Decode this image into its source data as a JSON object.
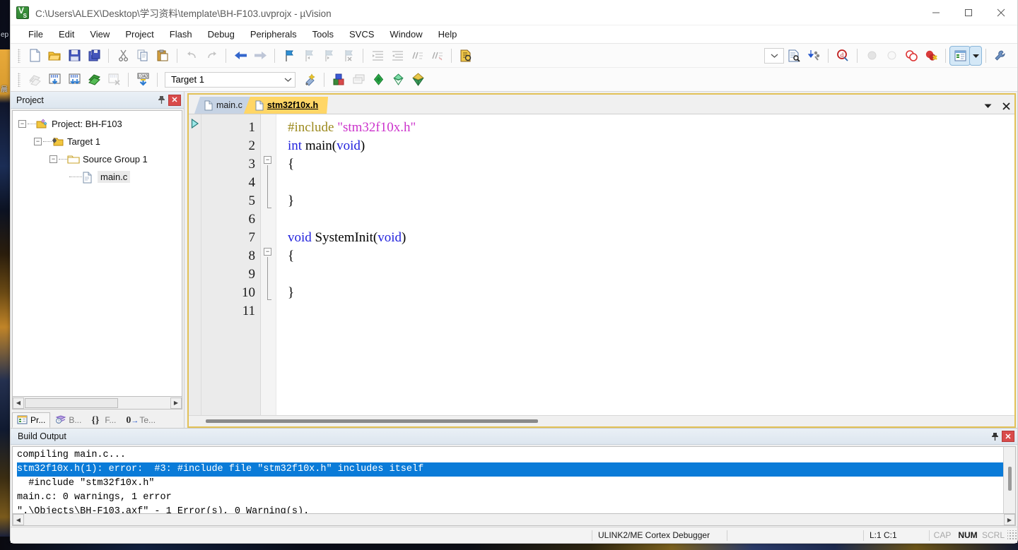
{
  "window": {
    "title": "C:\\Users\\ALEX\\Desktop\\学习资料\\template\\BH-F103.uvprojx - µVision",
    "app_icon": "uvision-icon",
    "minimize": "—",
    "maximize": "□",
    "close": "✕"
  },
  "menu": {
    "items": [
      {
        "label": "File"
      },
      {
        "label": "Edit"
      },
      {
        "label": "View"
      },
      {
        "label": "Project"
      },
      {
        "label": "Flash"
      },
      {
        "label": "Debug"
      },
      {
        "label": "Peripherals"
      },
      {
        "label": "Tools"
      },
      {
        "label": "SVCS"
      },
      {
        "label": "Window"
      },
      {
        "label": "Help"
      }
    ]
  },
  "toolbar_file": {
    "buttons": [
      {
        "name": "new-file-icon",
        "title": "New"
      },
      {
        "name": "open-file-icon",
        "title": "Open"
      },
      {
        "name": "save-icon",
        "title": "Save"
      },
      {
        "name": "save-all-icon",
        "title": "Save All"
      },
      {
        "name": "cut-icon",
        "title": "Cut"
      },
      {
        "name": "copy-icon",
        "title": "Copy"
      },
      {
        "name": "paste-icon",
        "title": "Paste"
      },
      {
        "name": "undo-icon",
        "title": "Undo"
      },
      {
        "name": "redo-icon",
        "title": "Redo"
      },
      {
        "name": "navigate-back-icon",
        "title": "Back"
      },
      {
        "name": "navigate-forward-icon",
        "title": "Forward"
      },
      {
        "name": "bookmark-toggle-icon",
        "title": "Insert/Remove Bookmark"
      },
      {
        "name": "bookmark-prev-icon",
        "title": "Previous Bookmark"
      },
      {
        "name": "bookmark-next-icon",
        "title": "Next Bookmark"
      },
      {
        "name": "bookmark-clear-icon",
        "title": "Clear All Bookmarks"
      },
      {
        "name": "indent-right-icon",
        "title": "Indent"
      },
      {
        "name": "indent-left-icon",
        "title": "Outdent"
      },
      {
        "name": "comment-icon",
        "title": "Comment"
      },
      {
        "name": "uncomment-icon",
        "title": "Uncomment"
      },
      {
        "name": "find-in-files-icon",
        "title": "Find in Files"
      },
      {
        "name": "find-icon",
        "title": "Find"
      },
      {
        "name": "go-to-definition-icon",
        "title": "Go To Definition"
      },
      {
        "name": "config-wizard-icon",
        "title": "Configuration Wizard"
      },
      {
        "name": "insert-breakpoint-icon",
        "title": "Insert/Remove Breakpoint"
      },
      {
        "name": "disable-breakpoint-icon",
        "title": "Enable/Disable Breakpoint"
      },
      {
        "name": "disable-all-breakpoints-icon",
        "title": "Disable All Breakpoints"
      },
      {
        "name": "kill-all-breakpoints-icon",
        "title": "Kill All Breakpoints"
      },
      {
        "name": "project-window-icon",
        "title": "Project Window"
      },
      {
        "name": "project-window-dropdown-icon",
        "title": "Window Options"
      },
      {
        "name": "configure-icon",
        "title": "Configure"
      }
    ]
  },
  "toolbar_build": {
    "buttons": [
      {
        "name": "translate-icon",
        "title": "Translate"
      },
      {
        "name": "build-icon",
        "title": "Build"
      },
      {
        "name": "rebuild-icon",
        "title": "Rebuild"
      },
      {
        "name": "batch-build-icon",
        "title": "Batch Build"
      },
      {
        "name": "stop-build-icon",
        "title": "Stop Build"
      },
      {
        "name": "download-icon",
        "title": "Download"
      },
      {
        "name": "target-options-icon",
        "title": "Options for Target"
      },
      {
        "name": "manage-components-icon",
        "title": "Manage Components"
      },
      {
        "name": "pack-installer-icon",
        "title": "Pack Installer"
      },
      {
        "name": "manage-run-time-icon",
        "title": "Manage Run-Time Environment"
      },
      {
        "name": "multi-project-icon",
        "title": "Multi-Project"
      }
    ],
    "target": {
      "label": "Target 1",
      "dropdown_icon": "chevron-down-icon"
    }
  },
  "project_panel": {
    "title": "Project",
    "pin_icon": "pin-icon",
    "close_icon": "close-icon",
    "tree": [
      {
        "label": "Project: BH-F103",
        "icon": "project-icon",
        "depth": 0,
        "expander": "−",
        "selected": false
      },
      {
        "label": "Target 1",
        "icon": "target-folder-icon",
        "depth": 1,
        "expander": "−",
        "selected": false
      },
      {
        "label": "Source Group 1",
        "icon": "folder-icon",
        "depth": 2,
        "expander": "−",
        "selected": false
      },
      {
        "label": "main.c",
        "icon": "c-file-icon",
        "depth": 3,
        "expander": "",
        "selected": true
      }
    ],
    "tabs": [
      {
        "label": "Pr...",
        "icon": "project-tab-icon",
        "active": true
      },
      {
        "label": "B...",
        "icon": "books-tab-icon",
        "active": false
      },
      {
        "label": "F...",
        "icon": "functions-tab-icon",
        "active": false
      },
      {
        "label": "Te...",
        "icon": "templates-tab-icon",
        "active": false
      }
    ],
    "scroll_left_icon": "arrow-left-icon",
    "scroll_right_icon": "arrow-right-icon"
  },
  "editor": {
    "tabs": [
      {
        "label": "main.c",
        "active": false,
        "icon": "c-file-icon"
      },
      {
        "label": "stm32f10x.h",
        "active": true,
        "icon": "h-file-icon"
      }
    ],
    "dropdown_icon": "chevron-down-icon",
    "close_icon": "close-icon",
    "line_numbers": [
      "1",
      "2",
      "3",
      "4",
      "5",
      "6",
      "7",
      "8",
      "9",
      "10",
      "11"
    ],
    "code_lines": [
      {
        "n": 1,
        "tokens": [
          {
            "t": "#include ",
            "c": "pre"
          },
          {
            "t": "\"stm32f10x.h\"",
            "c": "str"
          }
        ]
      },
      {
        "n": 2,
        "tokens": [
          {
            "t": "int",
            "c": "kw"
          },
          {
            "t": " main(",
            "c": "id"
          },
          {
            "t": "void",
            "c": "kw"
          },
          {
            "t": ")",
            "c": "id"
          }
        ]
      },
      {
        "n": 3,
        "tokens": [
          {
            "t": "{",
            "c": "id"
          }
        ]
      },
      {
        "n": 4,
        "tokens": []
      },
      {
        "n": 5,
        "tokens": [
          {
            "t": "}",
            "c": "id"
          }
        ]
      },
      {
        "n": 6,
        "tokens": []
      },
      {
        "n": 7,
        "tokens": [
          {
            "t": "void",
            "c": "kw"
          },
          {
            "t": " SystemInit(",
            "c": "id"
          },
          {
            "t": "void",
            "c": "kw"
          },
          {
            "t": ")",
            "c": "id"
          }
        ]
      },
      {
        "n": 8,
        "tokens": [
          {
            "t": "{",
            "c": "id"
          }
        ]
      },
      {
        "n": 9,
        "tokens": []
      },
      {
        "n": 10,
        "tokens": [
          {
            "t": "}",
            "c": "id"
          }
        ]
      },
      {
        "n": 11,
        "tokens": []
      }
    ],
    "fold_markers": [
      {
        "line": 3,
        "glyph": "−"
      },
      {
        "line": 8,
        "glyph": "−"
      }
    ],
    "exec_marker_icon": "execution-arrow-icon"
  },
  "build_output": {
    "title": "Build Output",
    "pin_icon": "pin-icon",
    "close_icon": "close-icon",
    "lines": [
      {
        "text": "compiling main.c...",
        "highlighted": false
      },
      {
        "text": "stm32f10x.h(1): error:  #3: #include file \"stm32f10x.h\" includes itself",
        "highlighted": true
      },
      {
        "text": "  #include \"stm32f10x.h\"",
        "highlighted": false
      },
      {
        "text": "main.c: 0 warnings, 1 error",
        "highlighted": false
      },
      {
        "text": "\".\\Objects\\BH-F103.axf\" - 1 Error(s), 0 Warning(s).",
        "highlighted": false
      }
    ],
    "scroll_left_icon": "arrow-left-icon",
    "scroll_right_icon": "arrow-right-icon"
  },
  "statusbar": {
    "debugger": "ULINK2/ME Cortex Debugger",
    "position": "L:1 C:1",
    "indicators": [
      {
        "label": "CAP",
        "active": false
      },
      {
        "label": "NUM",
        "active": true
      },
      {
        "label": "SCRL",
        "active": false
      }
    ]
  },
  "colors": {
    "accent_yellow": "#ffd666",
    "editor_border": "#e2c157",
    "error_highlight": "#0a7bd8",
    "keyword": "#2222dd",
    "string": "#cc33cc",
    "preprocessor": "#9c8a1e"
  }
}
